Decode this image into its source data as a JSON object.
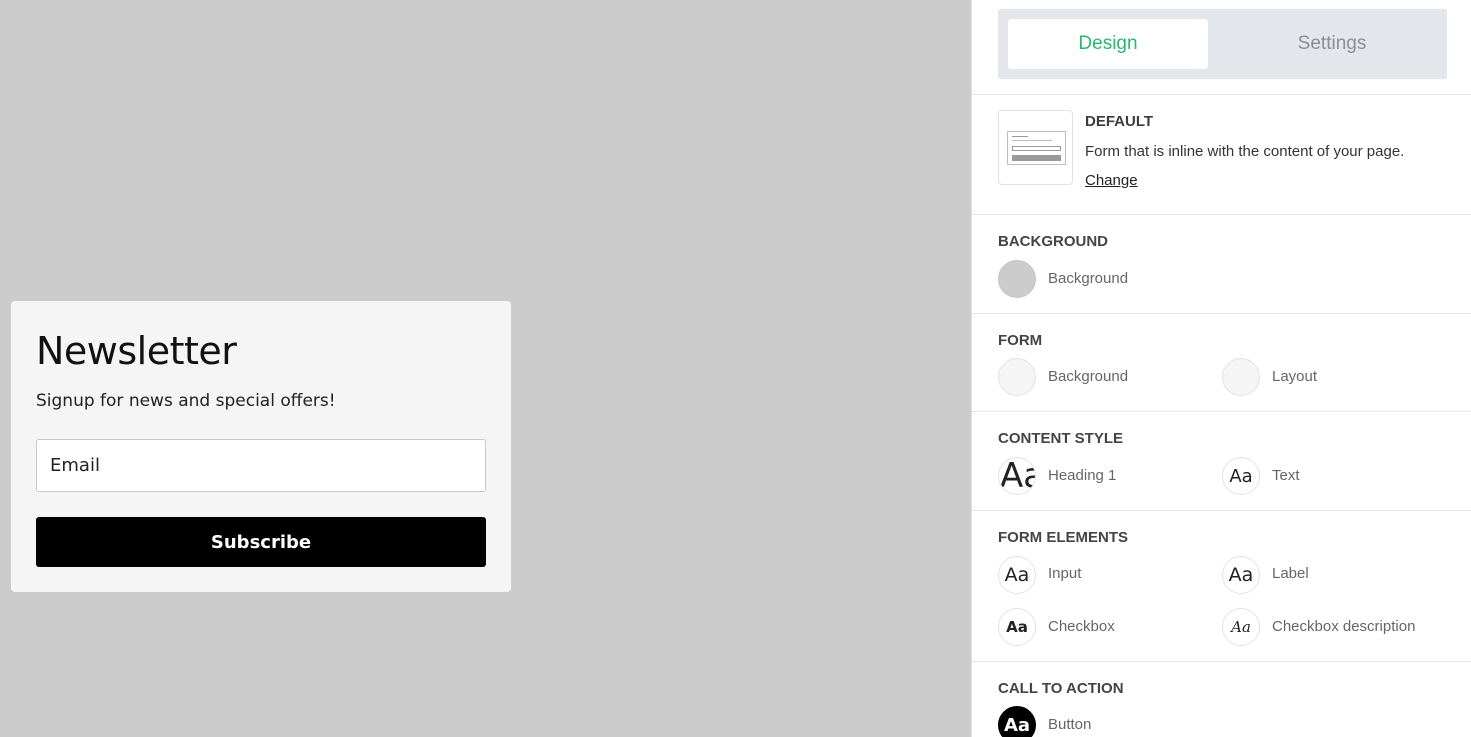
{
  "preview": {
    "title": "Newsletter",
    "subtitle": "Signup for news and special offers!",
    "email_placeholder": "Email",
    "subscribe_label": "Subscribe"
  },
  "panel": {
    "tabs": [
      {
        "label": "Design",
        "active": true
      },
      {
        "label": "Settings",
        "active": false
      }
    ],
    "template": {
      "name": "DEFAULT",
      "description": "Form that is inline with the content of your page.",
      "change_label": "Change"
    },
    "background": {
      "title": "BACKGROUND",
      "items": [
        {
          "label": "Background",
          "color": "#cccccc"
        }
      ]
    },
    "form": {
      "title": "FORM",
      "items": [
        {
          "label": "Background",
          "color": "#f5f5f5"
        },
        {
          "label": "Layout",
          "color": "#f5f5f5"
        }
      ]
    },
    "content_style": {
      "title": "CONTENT STYLE",
      "items": [
        {
          "label": "Heading 1",
          "glyph": "Aa"
        },
        {
          "label": "Text",
          "glyph": "Aa"
        }
      ]
    },
    "form_elements": {
      "title": "FORM ELEMENTS",
      "items": [
        {
          "label": "Input",
          "glyph": "Aa"
        },
        {
          "label": "Label",
          "glyph": "Aa"
        },
        {
          "label": "Checkbox",
          "glyph": "Aa"
        },
        {
          "label": "Checkbox description",
          "glyph": "Aa"
        }
      ]
    },
    "call_to_action": {
      "title": "CALL TO ACTION",
      "items": [
        {
          "label": "Button",
          "glyph": "Aa"
        }
      ]
    }
  },
  "colors": {
    "accent": "#2bb673",
    "canvas": "#cccccc",
    "card": "#f5f5f5",
    "button": "#000000"
  }
}
